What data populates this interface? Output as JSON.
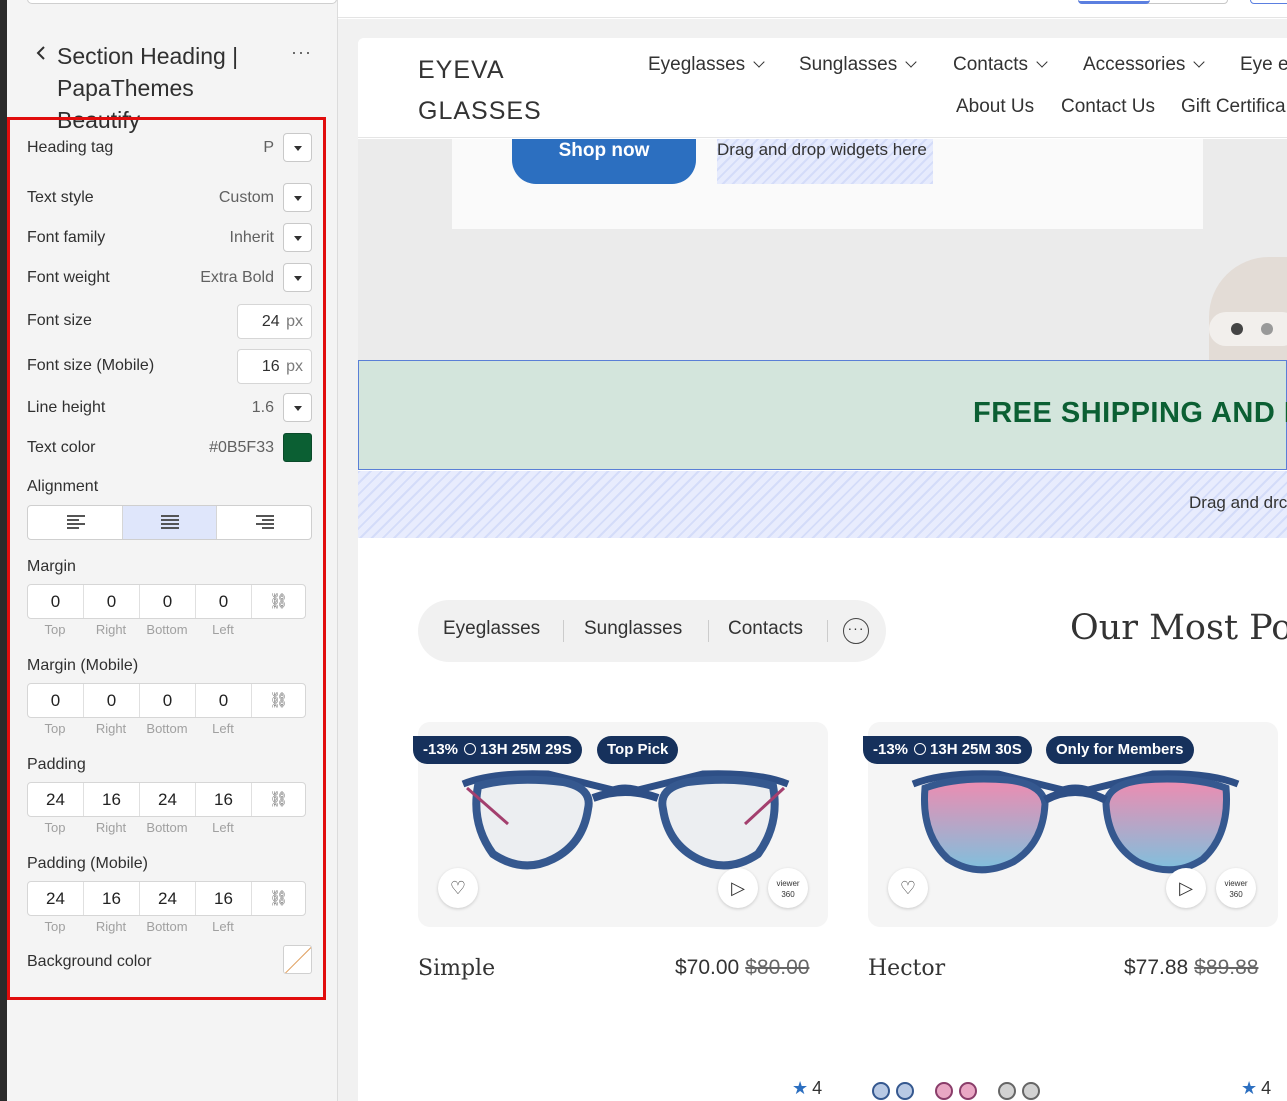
{
  "editor": {
    "back_icon": "chevron-left-icon",
    "title_line1": "Section Heading |",
    "title_line2": "PapaThemes Beautify",
    "more_label": "···",
    "settings": {
      "heading_tag": {
        "label": "Heading tag",
        "value": "P"
      },
      "text_style": {
        "label": "Text style",
        "value": "Custom"
      },
      "font_family": {
        "label": "Font family",
        "value": "Inherit"
      },
      "font_weight": {
        "label": "Font weight",
        "value": "Extra Bold"
      },
      "font_size": {
        "label": "Font size",
        "value": "24",
        "unit": "px"
      },
      "font_size_mobile": {
        "label": "Font size (Mobile)",
        "value": "16",
        "unit": "px"
      },
      "line_height": {
        "label": "Line height",
        "value": "1.6"
      },
      "text_color": {
        "label": "Text color",
        "value": "#0B5F33",
        "swatch": "#0B5F33"
      },
      "alignment": {
        "label": "Alignment",
        "options": [
          "left",
          "center",
          "right"
        ],
        "selected": "center"
      },
      "margin": {
        "label": "Margin",
        "values": [
          "0",
          "0",
          "0",
          "0"
        ]
      },
      "margin_mobile": {
        "label": "Margin (Mobile)",
        "values": [
          "0",
          "0",
          "0",
          "0"
        ]
      },
      "padding": {
        "label": "Padding",
        "values": [
          "24",
          "16",
          "24",
          "16"
        ]
      },
      "padding_mobile": {
        "label": "Padding (Mobile)",
        "values": [
          "24",
          "16",
          "24",
          "16"
        ]
      },
      "side_labels": [
        "Top",
        "Right",
        "Bottom",
        "Left"
      ],
      "background_color": {
        "label": "Background color",
        "value": "none"
      }
    }
  },
  "preview": {
    "logo_line1": "EYEVA",
    "logo_line2": "GLASSES",
    "nav_top": [
      "Eyeglasses",
      "Sunglasses",
      "Contacts",
      "Accessories",
      "Eye e"
    ],
    "nav_bottom": [
      "About Us",
      "Contact Us",
      "Gift Certifica"
    ],
    "hero": {
      "button": "Shop now",
      "dropzone": "Drag and drop widgets here"
    },
    "banner_text": "FREE SHIPPING AND I",
    "dropzone2": "Drag and drc",
    "tabs": [
      "Eyeglasses",
      "Sunglasses",
      "Contacts"
    ],
    "section_title": "Our Most Pop",
    "products": [
      {
        "name": "Simple",
        "price": "$70.00",
        "old_price": "$80.00",
        "discount": "-13%",
        "timer": "13H 25M 29S",
        "tag": "Top Pick",
        "rating": "4",
        "lens_color": "clear"
      },
      {
        "name": "Hector",
        "price": "$77.88",
        "old_price": "$89.88",
        "discount": "-13%",
        "timer": "13H 25M 30S",
        "tag": "Only for Members",
        "rating": "4",
        "lens_color": "pink-blue gradient"
      }
    ],
    "colors": {
      "accent": "#2C6FC0",
      "badge": "#16315C",
      "banner_bg": "#D3E5DC",
      "banner_text": "#0B5F33"
    }
  }
}
